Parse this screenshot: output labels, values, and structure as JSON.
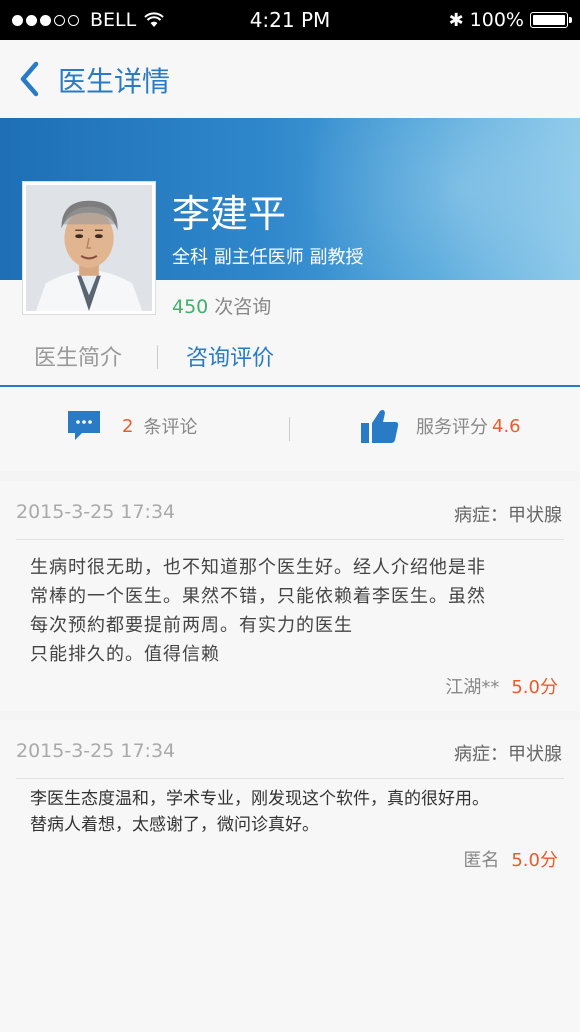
{
  "status_bar": {
    "carrier": "BELL",
    "time": "4:21 PM",
    "battery": "100%"
  },
  "nav": {
    "title": "医生详情"
  },
  "doctor": {
    "name": "李建平",
    "title": "全科  副主任医师  副教授",
    "consult_count": "450",
    "consult_label": "次咨询"
  },
  "tabs": [
    {
      "label": "医生简介"
    },
    {
      "label": "咨询评价"
    }
  ],
  "stats": {
    "review_count": "2",
    "review_label": "条评论",
    "rating_label": "服务评分",
    "rating_value": "4.6"
  },
  "reviews": [
    {
      "date": "2015-3-25 17:34",
      "disease": "病症：甲状腺",
      "lines": [
        "生病时很无助，也不知道那个医生好。经人介绍他是非",
        "常棒的一个医生。果然不错，只能依赖着李医生。虽然",
        "每次预約都要提前两周。有实力的医生",
        "只能排久的。值得信赖"
      ],
      "user": "江湖**",
      "score": "5.0分"
    },
    {
      "date": "2015-3-25 17:34",
      "disease": "病症：甲状腺",
      "lines": [
        "李医生态度温和，学术专业，刚发现这个软件，真的很好用。",
        "替病人着想，太感谢了，微问诊真好。"
      ],
      "user": "匿名",
      "score": "5.0分"
    }
  ],
  "colors": {
    "accent": "#2a7bc6",
    "score": "#e65d2b",
    "consult": "#3db36b"
  }
}
